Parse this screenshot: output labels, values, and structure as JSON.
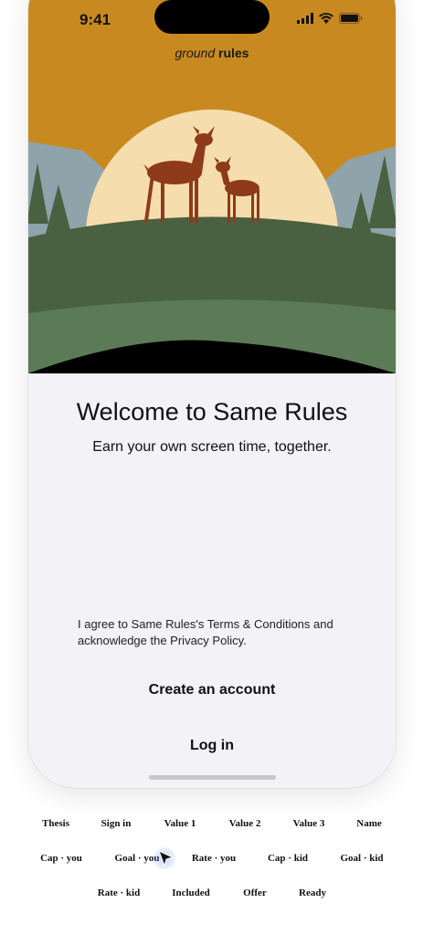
{
  "status_bar": {
    "time": "9:41"
  },
  "brand": {
    "word1": "ground",
    "word2": "rules"
  },
  "welcome": {
    "title": "Welcome to Same Rules",
    "subtitle": "Earn your own screen time, together."
  },
  "terms": {
    "line1": "I agree to Same Rules's Terms & Conditions and",
    "line2": "acknowledge the Privacy Policy."
  },
  "actions": {
    "create_label": "Create an account",
    "login_label": "Log in"
  },
  "nav": {
    "row1": [
      "Thesis",
      "Sign in",
      "Value 1",
      "Value 2",
      "Value 3",
      "Name"
    ],
    "row2": [
      "Cap · you",
      "Goal · you",
      "Rate · you",
      "Cap · kid",
      "Goal · kid"
    ],
    "row3": [
      "Rate · kid",
      "Included",
      "Offer",
      "Ready"
    ]
  },
  "colors": {
    "sky": "#c88a20",
    "sun": "#f6ddad",
    "hill_dark": "#4a6141",
    "hill_light": "#5b7a56",
    "mountain": "#8fa3ab",
    "deer": "#8e3b1c",
    "background": "#f2f2f7"
  },
  "icons": [
    "signal-icon",
    "wifi-icon",
    "battery-icon",
    "deer-illustration",
    "pointer-cursor-icon"
  ]
}
